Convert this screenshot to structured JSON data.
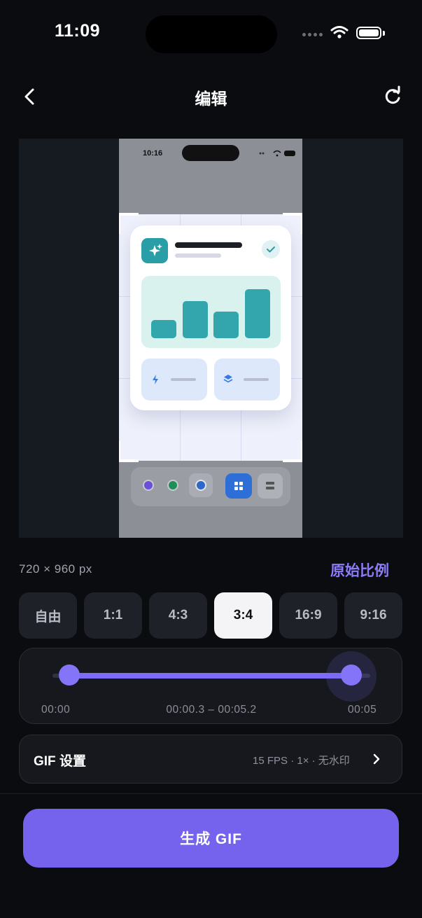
{
  "status_bar": {
    "time": "11:09"
  },
  "nav": {
    "title": "编辑",
    "back_icon": "chevron-left-icon",
    "reset_icon": "refresh-icon"
  },
  "preview": {
    "inner_screenshot_time": "10:16"
  },
  "size": {
    "dimensions": "720 × 960 px",
    "original_ratio_label": "原始比例"
  },
  "ratios": [
    {
      "label": "自由",
      "selected": false
    },
    {
      "label": "1:1",
      "selected": false
    },
    {
      "label": "4:3",
      "selected": false
    },
    {
      "label": "3:4",
      "selected": true
    },
    {
      "label": "16:9",
      "selected": false
    },
    {
      "label": "9:16",
      "selected": false
    }
  ],
  "timeline": {
    "start": "00:00",
    "range": "00:00.3 – 00:05.2",
    "end": "00:05",
    "accent": "#7d6cf5"
  },
  "gif_settings": {
    "title": "GIF 设置",
    "summary": "15 FPS · 1× · 无水印"
  },
  "generate_button": {
    "label": "生成 GIF",
    "color": "#7563ee"
  }
}
